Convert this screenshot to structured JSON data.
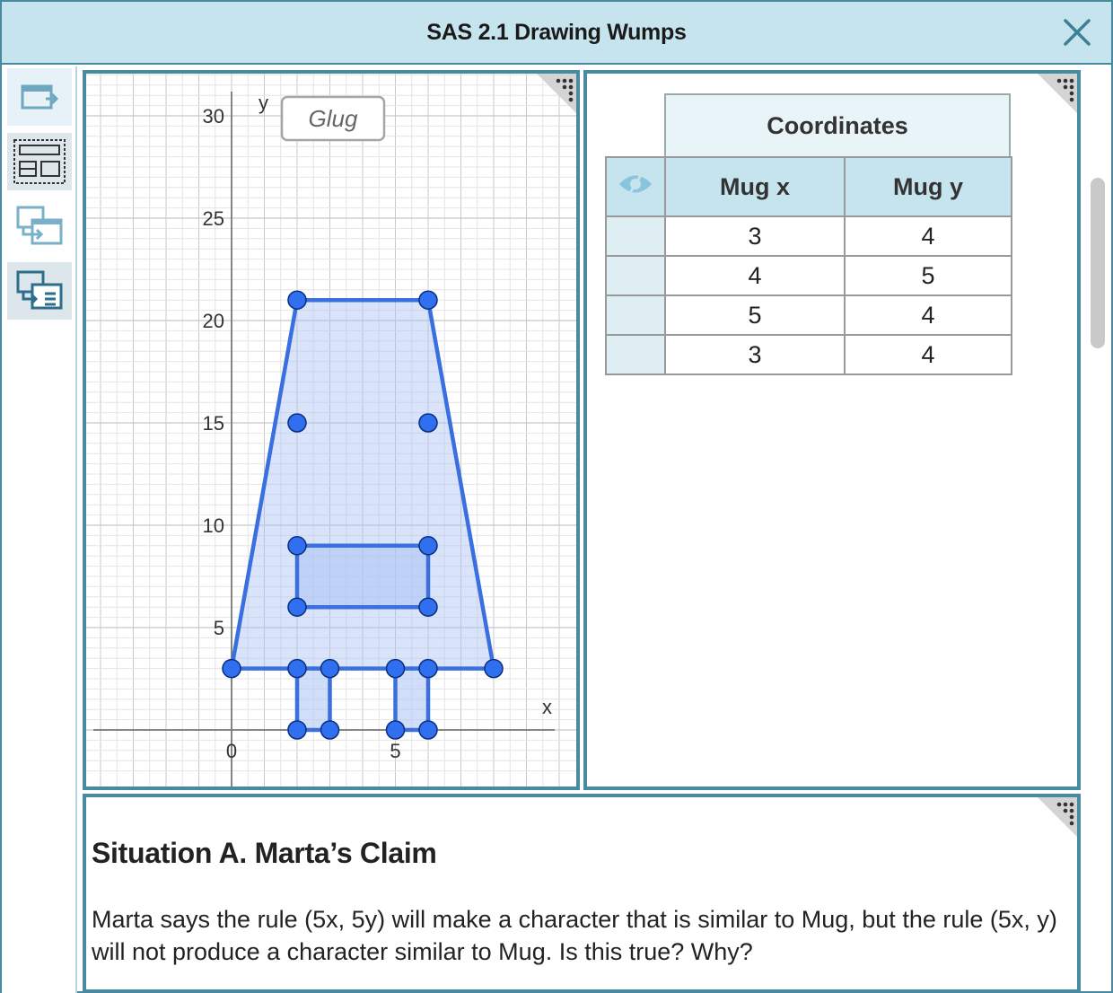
{
  "window": {
    "title": "SAS 2.1 Drawing Wumps"
  },
  "toolbar": {
    "tools": [
      "screen-share-icon",
      "layout-icon",
      "screen-transfer-icon",
      "screen-transfer-text-icon"
    ]
  },
  "graph": {
    "label_box": "Glug",
    "x_axis_label": "x",
    "y_axis_label": "y",
    "y_ticks": [
      "30",
      "25",
      "20",
      "15",
      "10",
      "5"
    ],
    "x_ticks": [
      "0",
      "5"
    ],
    "colors": {
      "shape_fill": "#aac2f4",
      "shape_stroke": "#3a6fe0",
      "point": "#2f6ff0",
      "grid_major": "#c8c8c8",
      "grid_minor": "#e4e4e4"
    }
  },
  "chart_data": {
    "type": "scatter",
    "xlim": [
      -4,
      10
    ],
    "ylim": [
      -2,
      31
    ],
    "grid": true,
    "shapes": [
      {
        "name": "body",
        "points": [
          [
            0,
            3
          ],
          [
            2,
            21
          ],
          [
            6,
            21
          ],
          [
            8,
            3
          ]
        ]
      },
      {
        "name": "inner",
        "points": [
          [
            2,
            9
          ],
          [
            6,
            9
          ],
          [
            6,
            6
          ],
          [
            2,
            6
          ]
        ]
      },
      {
        "name": "left-leg",
        "points": [
          [
            2,
            3
          ],
          [
            2,
            0
          ],
          [
            3,
            0
          ],
          [
            3,
            3
          ]
        ]
      },
      {
        "name": "right-leg",
        "points": [
          [
            5,
            3
          ],
          [
            5,
            0
          ],
          [
            6,
            0
          ],
          [
            6,
            3
          ]
        ]
      }
    ],
    "points": [
      [
        0,
        3
      ],
      [
        2,
        3
      ],
      [
        3,
        3
      ],
      [
        5,
        3
      ],
      [
        6,
        3
      ],
      [
        8,
        3
      ],
      [
        2,
        21
      ],
      [
        6,
        21
      ],
      [
        2,
        15
      ],
      [
        6,
        15
      ],
      [
        2,
        9
      ],
      [
        6,
        9
      ],
      [
        2,
        6
      ],
      [
        6,
        6
      ],
      [
        2,
        0
      ],
      [
        3,
        0
      ],
      [
        5,
        0
      ],
      [
        6,
        0
      ]
    ]
  },
  "table": {
    "title": "Coordinates",
    "columns": [
      "Mug x",
      "Mug y"
    ],
    "rows": [
      [
        "3",
        "4"
      ],
      [
        "4",
        "5"
      ],
      [
        "5",
        "4"
      ],
      [
        "3",
        "4"
      ]
    ]
  },
  "situation": {
    "title": "Situation A. Marta’s Claim",
    "text": "Marta says the rule (5x, 5y) will make a character that is similar to Mug, but the rule (5x, y) will not produce a character similar to Mug. Is this true? Why?"
  }
}
